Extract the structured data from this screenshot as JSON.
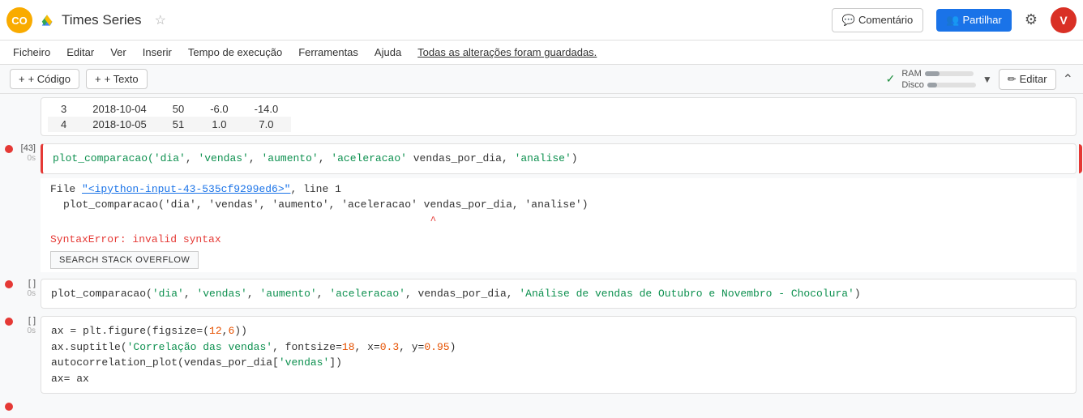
{
  "app": {
    "logo_text": "CO",
    "title": "Times Series",
    "drive_tooltip": "Google Drive",
    "star_char": "☆"
  },
  "topbar": {
    "comment_label": "Comentário",
    "share_label": "Partilhar",
    "settings_char": "⚙",
    "user_initial": "V"
  },
  "menubar": {
    "items": [
      "Ficheiro",
      "Editar",
      "Ver",
      "Inserir",
      "Tempo de execução",
      "Ferramentas",
      "Ajuda"
    ],
    "saved_message": "Todas as alterações foram guardadas."
  },
  "toolbar": {
    "add_code_label": "+ Código",
    "add_text_label": "+ Texto",
    "checkmark": "✓",
    "ram_label": "RAM",
    "disk_label": "Disco",
    "ram_percent": 30,
    "disk_percent": 20,
    "edit_label": "Editar",
    "pencil_char": "✏"
  },
  "cells": [
    {
      "id": "cell-table",
      "type": "output",
      "label": "",
      "time": "",
      "error": false,
      "table": {
        "rows": [
          {
            "idx": "3",
            "date": "2018-10-04",
            "col1": "50",
            "col2": "-6.0",
            "col3": "-14.0"
          },
          {
            "idx": "4",
            "date": "2018-10-05",
            "col1": "51",
            "col2": "1.0",
            "col3": "7.0"
          }
        ]
      }
    },
    {
      "id": "cell-43",
      "type": "code-error",
      "label": "[43]",
      "time": "0s",
      "error": true,
      "code": "plot_comparacao('dia', 'vendas', 'aumento', 'aceleracao' vendas_por_dia, 'analise')",
      "output": {
        "file_line": "File \"<ipython-input-43-535cf9299ed6>\", line 1",
        "code_echo": "    plot_comparacao('dia', 'vendas', 'aumento', 'aceleracao' vendas_por_dia, 'analise')",
        "caret": "                                                          ^",
        "error_type": "SyntaxError: invalid syntax",
        "btn_label": "SEARCH STACK OVERFLOW"
      }
    },
    {
      "id": "cell-empty1",
      "type": "code",
      "label": "[ ]",
      "time": "0s",
      "error": true,
      "code": "plot_comparacao('dia', 'vendas', 'aumento', 'aceleracao', vendas_por_dia, 'Análise de vendas de Outubro e Novembro - Chocolura')"
    },
    {
      "id": "cell-empty2",
      "type": "code",
      "label": "[ ]",
      "time": "0s",
      "error": true,
      "code_lines": [
        "ax = plt.figure(figsize=(12,6))",
        "ax.suptitle('Correlação das vendas', fontsize=18, x=0.3, y=0.95)",
        "autocorrelation_plot(vendas_por_dia['vendas'])",
        "ax= ax"
      ]
    }
  ]
}
